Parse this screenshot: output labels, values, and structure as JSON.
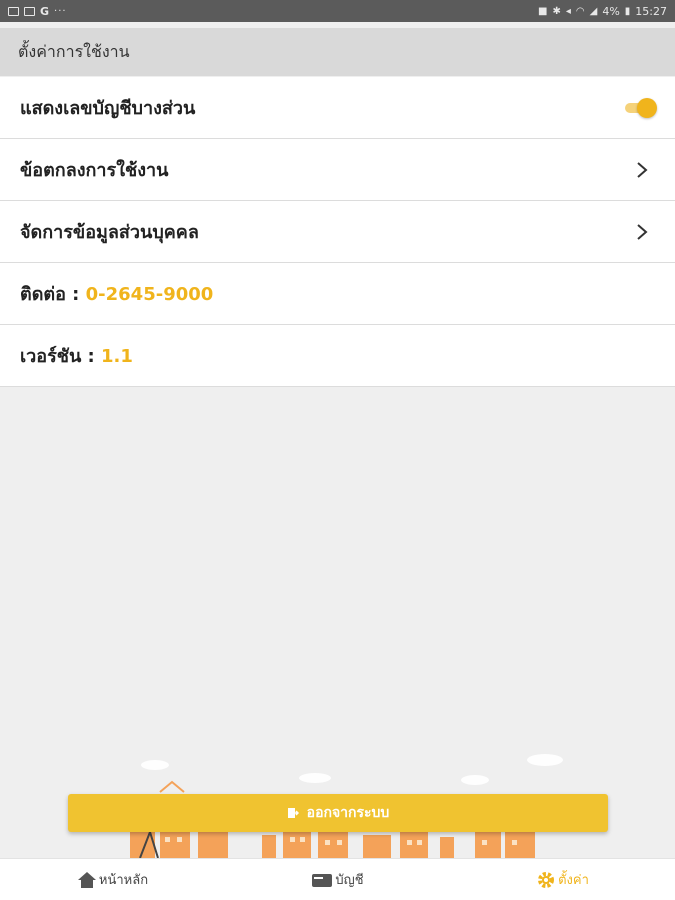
{
  "status_bar": {
    "left_icons": [
      "image-icon",
      "photo-icon",
      "google-icon",
      "more-icon"
    ],
    "google_label": "G",
    "more_label": "···",
    "right_icons": [
      "lock-icon",
      "bluetooth-icon",
      "mute-icon",
      "wifi-icon",
      "signal-icon",
      "battery-icon"
    ],
    "battery": "4%",
    "time": "15:27"
  },
  "header": {
    "title": "ตั้งค่าการใช้งาน"
  },
  "settings": {
    "show_partial_account": {
      "label": "แสดงเลขบัญชีบางส่วน",
      "enabled": true
    },
    "terms": {
      "label": "ข้อตกลงการใช้งาน"
    },
    "personal_data": {
      "label": "จัดการข้อมูลส่วนบุคคล"
    },
    "contact": {
      "label": "ติดต่อ : ",
      "value": "0-2645-9000"
    },
    "version": {
      "label": "เวอร์ชัน : ",
      "value": "1.1"
    }
  },
  "logout": {
    "label": "ออกจากระบบ",
    "icon": "logout-icon"
  },
  "tabbar": {
    "home": {
      "label": "หน้าหลัก",
      "icon": "home-icon"
    },
    "account": {
      "label": "บัญชี",
      "icon": "wallet-icon"
    },
    "settings": {
      "label": "ตั้งค่า",
      "icon": "gear-icon"
    }
  },
  "colors": {
    "accent": "#f0b41c",
    "button": "#f0c330",
    "header_bg": "#d9d9d9",
    "page_bg": "#efefef"
  }
}
